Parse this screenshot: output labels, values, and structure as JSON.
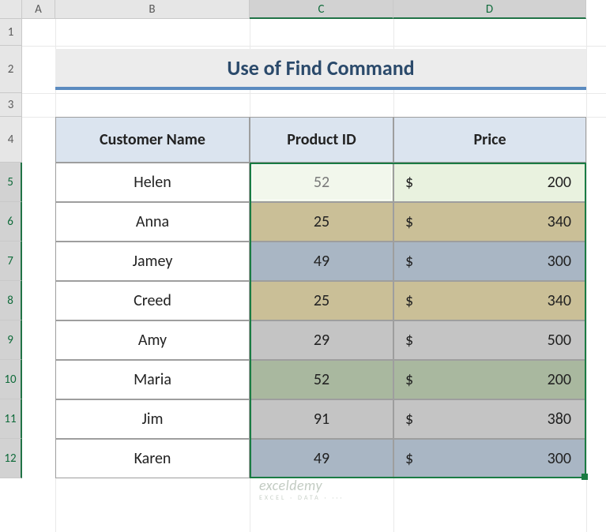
{
  "columns": [
    "A",
    "B",
    "C",
    "D"
  ],
  "rows": [
    "1",
    "2",
    "3",
    "4",
    "5",
    "6",
    "7",
    "8",
    "9",
    "10",
    "11",
    "12"
  ],
  "title": "Use of Find Command",
  "headers": {
    "name": "Customer Name",
    "id": "Product ID",
    "price": "Price"
  },
  "currency_symbol": "$",
  "data": [
    {
      "name": "Helen",
      "id": "52",
      "price": "200",
      "color": "#e9f2df"
    },
    {
      "name": "Anna",
      "id": "25",
      "price": "340",
      "color": "#cabf97"
    },
    {
      "name": "Jamey",
      "id": "49",
      "price": "300",
      "color": "#a9b6c4"
    },
    {
      "name": "Creed",
      "id": "25",
      "price": "340",
      "color": "#cabf97"
    },
    {
      "name": "Amy",
      "id": "29",
      "price": "500",
      "color": "#c4c4c4"
    },
    {
      "name": "Maria",
      "id": "52",
      "price": "200",
      "color": "#a9b89f"
    },
    {
      "name": "Jim",
      "id": "91",
      "price": "380",
      "color": "#c4c4c4"
    },
    {
      "name": "Karen",
      "id": "49",
      "price": "300",
      "color": "#a9b6c4"
    }
  ],
  "watermark": {
    "main": "exceldemy",
    "sub": "EXCEL · DATA · ···"
  },
  "chart_data": {
    "type": "table",
    "title": "Use of Find Command",
    "columns": [
      "Customer Name",
      "Product ID",
      "Price"
    ],
    "rows": [
      [
        "Helen",
        52,
        200
      ],
      [
        "Anna",
        25,
        340
      ],
      [
        "Jamey",
        49,
        300
      ],
      [
        "Creed",
        25,
        340
      ],
      [
        "Amy",
        29,
        500
      ],
      [
        "Maria",
        52,
        200
      ],
      [
        "Jim",
        91,
        380
      ],
      [
        "Karen",
        49,
        300
      ]
    ]
  }
}
